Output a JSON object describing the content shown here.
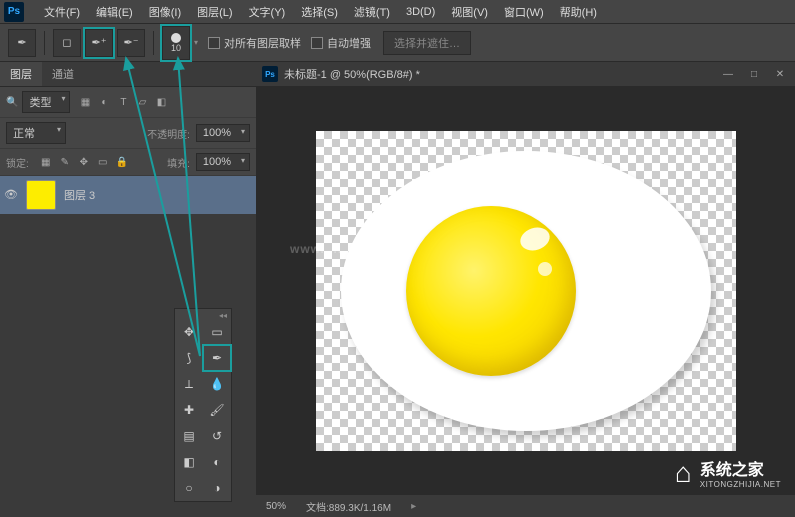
{
  "app": {
    "logo": "Ps"
  },
  "menu": {
    "file": "文件(F)",
    "edit": "编辑(E)",
    "image": "图像(I)",
    "layer": "图层(L)",
    "type": "文字(Y)",
    "select": "选择(S)",
    "filter": "滤镜(T)",
    "threeD": "3D(D)",
    "view": "视图(V)",
    "window": "窗口(W)",
    "help": "帮助(H)"
  },
  "options": {
    "brushSize": "10",
    "sampleAll": "对所有图层取样",
    "autoEnhance": "自动增强",
    "selectMask": "选择并遮住…"
  },
  "layersPanel": {
    "tabLayers": "图层",
    "tabChannels": "通道",
    "filterLabel": "类型",
    "blendMode": "正常",
    "opacityLabel": "不透明度:",
    "opacityValue": "100%",
    "lockLabel": "锁定:",
    "fillLabel": "填充:",
    "fillValue": "100%",
    "layerName": "图层 3"
  },
  "document": {
    "title": "未标题-1 @ 50%(RGB/8#) *"
  },
  "status": {
    "zoom": "50%",
    "docInfo": "文档:889.3K/1.16M"
  },
  "watermark": {
    "top": "www.........NET",
    "brandCN": "系统之家",
    "brandEN": "XITONGZHIJIA.NET"
  },
  "icons": {
    "search": "🔍",
    "move": "✥",
    "marquee": "▭",
    "lasso": "⟆",
    "wand": "✦",
    "crop": "⟂",
    "eyedrop": "💧",
    "heal": "✚",
    "brush": "🖌",
    "stamp": "▤",
    "history": "↺",
    "eraser": "◧",
    "gradient": "◐",
    "blur": "○",
    "dodge": "◑"
  }
}
